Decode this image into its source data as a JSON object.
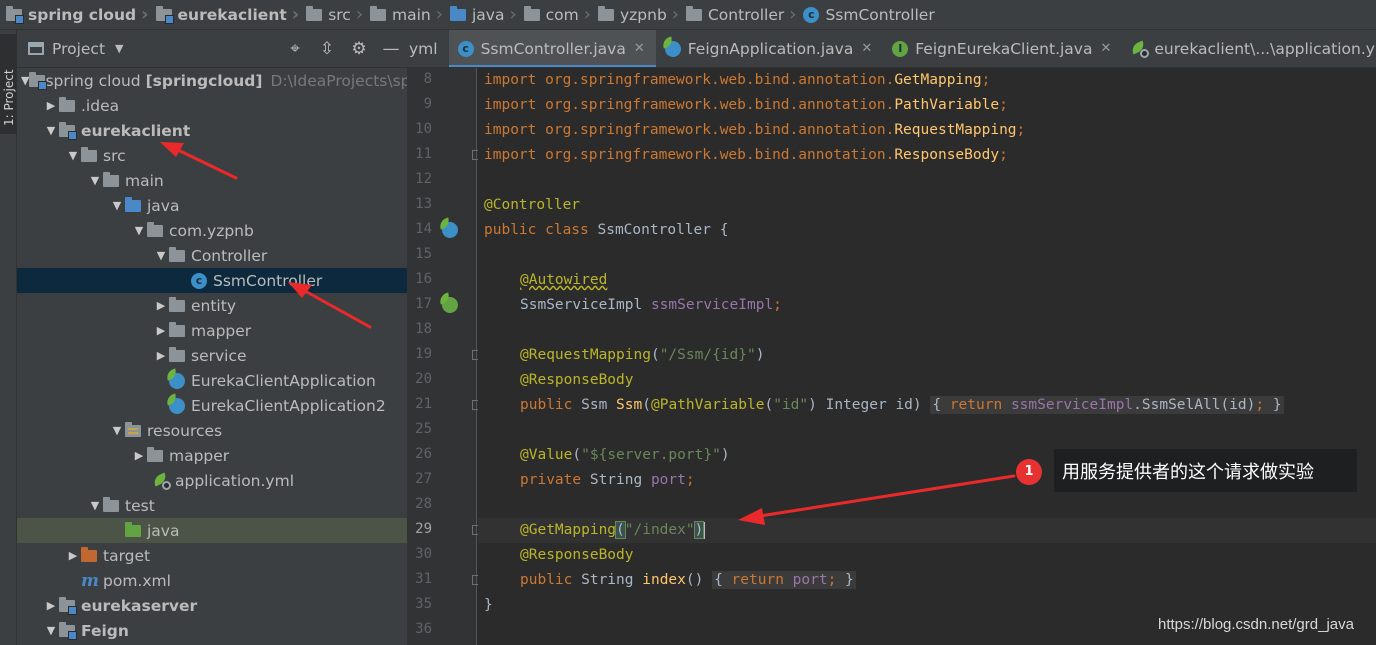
{
  "breadcrumb": [
    "spring cloud",
    "eurekaclient",
    "src",
    "main",
    "java",
    "com",
    "yzpnb",
    "Controller",
    "SsmController"
  ],
  "side_strip": {
    "label": "1: Project"
  },
  "project_panel": {
    "title": "Project",
    "tools": [
      "crosshair-icon",
      "collapse-icon",
      "gear-icon",
      "minimize-icon"
    ],
    "tree": [
      {
        "label": "spring cloud",
        "bracket": "[springcloud]",
        "path": "D:\\IdeaProjects\\spr"
      },
      {
        "label": ".idea"
      },
      {
        "label": "eurekaclient"
      },
      {
        "label": "src"
      },
      {
        "label": "main"
      },
      {
        "label": "java"
      },
      {
        "label": "com.yzpnb"
      },
      {
        "label": "Controller"
      },
      {
        "label": "SsmController"
      },
      {
        "label": "entity"
      },
      {
        "label": "mapper"
      },
      {
        "label": "service"
      },
      {
        "label": "EurekaClientApplication"
      },
      {
        "label": "EurekaClientApplication2"
      },
      {
        "label": "resources"
      },
      {
        "label": "mapper"
      },
      {
        "label": "application.yml"
      },
      {
        "label": "test"
      },
      {
        "label": "java"
      },
      {
        "label": "target"
      },
      {
        "label": "pom.xml"
      },
      {
        "label": "eurekaserver"
      },
      {
        "label": "Feign"
      }
    ]
  },
  "tabs": [
    {
      "label": "yml"
    },
    {
      "label": "SsmController.java"
    },
    {
      "label": "FeignApplication.java"
    },
    {
      "label": "FeignEurekaClient.java"
    },
    {
      "label": "eurekaclient\\...\\application.yml"
    }
  ],
  "gutter": {
    "line_numbers": [
      "8",
      "9",
      "10",
      "11",
      "12",
      "13",
      "14",
      "15",
      "16",
      "17",
      "18",
      "19",
      "20",
      "21",
      "25",
      "26",
      "27",
      "28",
      "29",
      "30",
      "31",
      "35",
      "36"
    ]
  },
  "code": {
    "l8": {
      "a": "import org.springframework.web.bind.annotation.",
      "b": "GetMapping",
      "c": ";"
    },
    "l9": {
      "a": "import org.springframework.web.bind.annotation.",
      "b": "PathVariable",
      "c": ";"
    },
    "l10": {
      "a": "import org.springframework.web.bind.annotation.",
      "b": "RequestMapping",
      "c": ";"
    },
    "l11": {
      "a": "import org.springframework.web.bind.annotation.",
      "b": "ResponseBody",
      "c": ";"
    },
    "l13": "@Controller",
    "l14": {
      "kw": "public class",
      "rest": " SsmController {"
    },
    "l16": "@Autowired",
    "l17": {
      "type": "SsmServiceImpl ",
      "field": "ssmServiceImpl",
      "end": ";"
    },
    "l19": {
      "ann": "@RequestMapping",
      "open": "(",
      "str": "\"/Ssm/{id}\"",
      "close": ")"
    },
    "l20": "@ResponseBody",
    "l21": {
      "kw": "public",
      "t1": " Ssm ",
      "fn": "Ssm",
      "p1": "(",
      "ann": "@PathVariable",
      "p2": "(",
      "str": "\"id\"",
      "p3": ") Integer id) ",
      "br1": "{",
      "ret": " return ",
      "field": "ssmServiceImpl",
      "call": ".SsmSelAll(id)",
      "semi": ";",
      "br2": " }"
    },
    "l26": {
      "ann": "@Value",
      "open": "(",
      "str": "\"${server.port}\"",
      "close": ")"
    },
    "l27": {
      "kw": "private",
      "type": " String ",
      "field": "port",
      "end": ";"
    },
    "l29": {
      "ann": "@GetMapping",
      "open": "(",
      "str": "\"/index\"",
      "close": ")"
    },
    "l30": "@ResponseBody",
    "l31": {
      "kw": "public",
      "t1": " String ",
      "fn": "index",
      "p": "() ",
      "br1": "{",
      "ret": " return ",
      "field": "port",
      "semi": ";",
      "br2": " }"
    },
    "l35": "}"
  },
  "annotation": {
    "number": "1",
    "text": "用服务提供者的这个请求做实验"
  },
  "watermark": "https://blog.csdn.net/grd_java",
  "colors": {
    "keyword": "#cc7832",
    "annotation": "#bbb529",
    "string": "#6a8759",
    "field": "#9876aa",
    "method": "#ffc66d",
    "arrow": "#ea2a2a"
  }
}
